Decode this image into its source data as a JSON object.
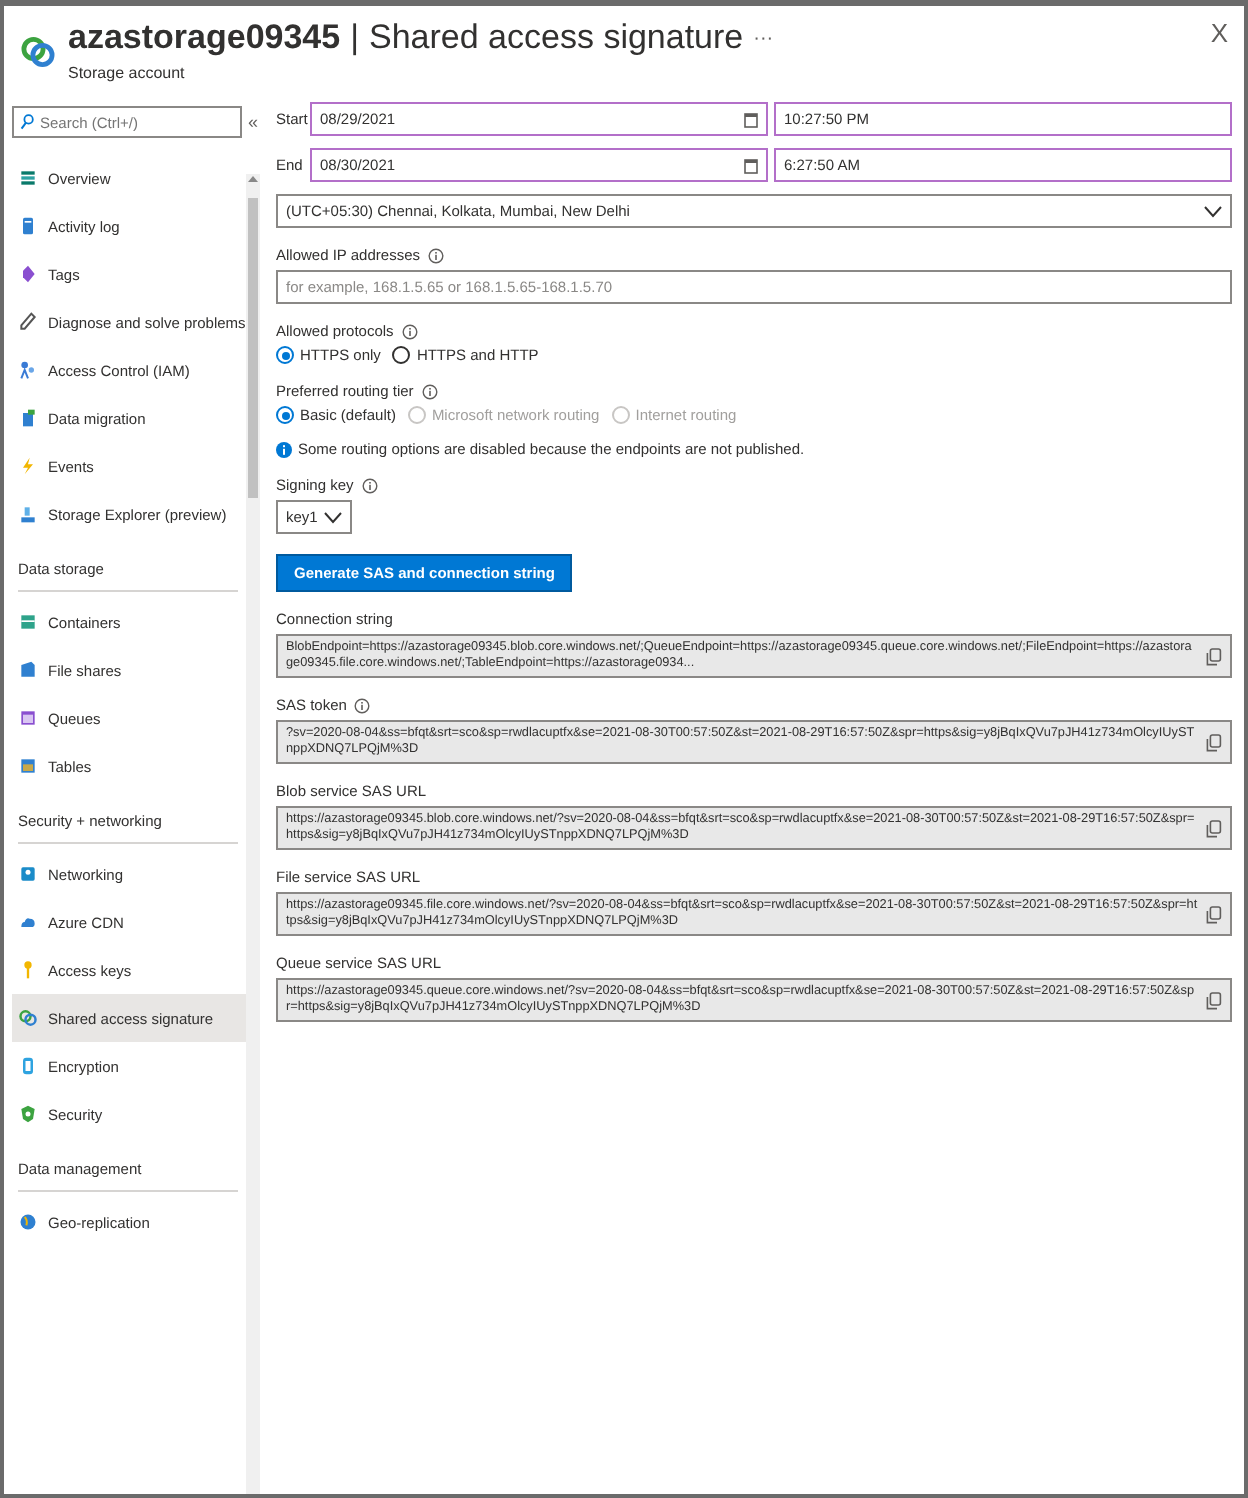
{
  "header": {
    "resource": "azastorage09345",
    "separator": "|",
    "page": "Shared access signature",
    "more": "···",
    "subtitle": "Storage account",
    "close": "X"
  },
  "sidebar": {
    "search": {
      "placeholder": "Search (Ctrl+/)"
    },
    "collapse": "«",
    "groups": [
      {
        "items": [
          {
            "label": "Overview",
            "selected": false
          },
          {
            "label": "Activity log",
            "selected": false
          },
          {
            "label": "Tags",
            "selected": false
          },
          {
            "label": "Diagnose and solve problems",
            "selected": false
          },
          {
            "label": "Access Control (IAM)",
            "selected": false
          },
          {
            "label": "Data migration",
            "selected": false
          },
          {
            "label": "Events",
            "selected": false
          },
          {
            "label": "Storage Explorer (preview)",
            "selected": false
          }
        ]
      },
      {
        "heading": "Data storage",
        "items": [
          {
            "label": "Containers",
            "selected": false
          },
          {
            "label": "File shares",
            "selected": false
          },
          {
            "label": "Queues",
            "selected": false
          },
          {
            "label": "Tables",
            "selected": false
          }
        ]
      },
      {
        "heading": "Security + networking",
        "items": [
          {
            "label": "Networking",
            "selected": false
          },
          {
            "label": "Azure CDN",
            "selected": false
          },
          {
            "label": "Access keys",
            "selected": false
          },
          {
            "label": "Shared access signature",
            "selected": true
          },
          {
            "label": "Encryption",
            "selected": false
          },
          {
            "label": "Security",
            "selected": false
          }
        ]
      },
      {
        "heading": "Data management",
        "items": [
          {
            "label": "Geo-replication",
            "selected": false
          }
        ]
      }
    ]
  },
  "form": {
    "dates": [
      {
        "label": "Start",
        "date": "08/29/2021",
        "time": "10:27:50 PM"
      },
      {
        "label": "End",
        "date": "08/30/2021",
        "time": "6:27:50 AM"
      }
    ],
    "timezone": "(UTC+05:30) Chennai, Kolkata, Mumbai, New Delhi",
    "ip": {
      "label": "Allowed IP addresses",
      "placeholder": "for example, 168.1.5.65 or 168.1.5.65-168.1.5.70"
    },
    "radio_groups": [
      {
        "label": "Allowed protocols",
        "options": [
          {
            "label": "HTTPS only",
            "selected": true,
            "disabled": false
          },
          {
            "label": "HTTPS and HTTP",
            "selected": false,
            "disabled": false
          }
        ]
      },
      {
        "label": "Preferred routing tier",
        "options": [
          {
            "label": "Basic (default)",
            "selected": true,
            "disabled": false
          },
          {
            "label": "Microsoft network routing",
            "selected": false,
            "disabled": true
          },
          {
            "label": "Internet routing",
            "selected": false,
            "disabled": true
          }
        ]
      }
    ],
    "info": "Some routing options are disabled because the endpoints are not published.",
    "signing_key": {
      "label": "Signing key",
      "value": "key1"
    },
    "button": "Generate SAS and connection string",
    "outputs": [
      {
        "label": "Connection string",
        "info": false,
        "value": "BlobEndpoint=https://azastorage09345.blob.core.windows.net/;QueueEndpoint=https://azastorage09345.queue.core.windows.net/;FileEndpoint=https://azastorage09345.file.core.windows.net/;TableEndpoint=https://azastorage0934..."
      },
      {
        "label": "SAS token",
        "info": true,
        "value": "?sv=2020-08-04&ss=bfqt&srt=sco&sp=rwdlacuptfx&se=2021-08-30T00:57:50Z&st=2021-08-29T16:57:50Z&spr=https&sig=y8jBqIxQVu7pJH41z734mOlcyIUySTnppXDNQ7LPQjM%3D"
      },
      {
        "label": "Blob service SAS URL",
        "info": false,
        "value": "https://azastorage09345.blob.core.windows.net/?sv=2020-08-04&ss=bfqt&srt=sco&sp=rwdlacuptfx&se=2021-08-30T00:57:50Z&st=2021-08-29T16:57:50Z&spr=https&sig=y8jBqIxQVu7pJH41z734mOlcyIUySTnppXDNQ7LPQjM%3D"
      },
      {
        "label": "File service SAS URL",
        "info": false,
        "value": "https://azastorage09345.file.core.windows.net/?sv=2020-08-04&ss=bfqt&srt=sco&sp=rwdlacuptfx&se=2021-08-30T00:57:50Z&st=2021-08-29T16:57:50Z&spr=https&sig=y8jBqIxQVu7pJH41z734mOlcyIUySTnppXDNQ7LPQjM%3D"
      },
      {
        "label": "Queue service SAS URL",
        "info": false,
        "value": "https://azastorage09345.queue.core.windows.net/?sv=2020-08-04&ss=bfqt&srt=sco&sp=rwdlacuptfx&se=2021-08-30T00:57:50Z&st=2021-08-29T16:57:50Z&spr=https&sig=y8jBqIxQVu7pJH41z734mOlcyIUySTnppXDNQ7LPQjM%3D"
      }
    ]
  }
}
